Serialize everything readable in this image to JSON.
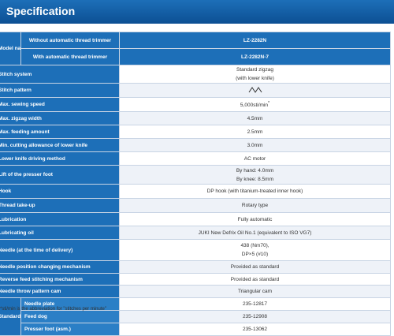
{
  "page": {
    "title": "Specification"
  },
  "header": {
    "model_name_label": "Model name",
    "without_trimmer_label": "Without automatic thread trimmer",
    "without_trimmer_model": "LZ-2282N",
    "with_trimmer_label": "With automatic thread trimmer",
    "with_trimmer_model": "LZ-2282N-7"
  },
  "rows": [
    {
      "label": "Stitch system",
      "values": [
        "Standard zigzag",
        "(with lower knife)"
      ]
    },
    {
      "label": "Stitch pattern",
      "icon": "zigzag-stitch-icon"
    },
    {
      "label": "Max. sewing speed",
      "value": "5,000sti/min",
      "sup": "*"
    },
    {
      "label": "Max. zigzag width",
      "value": "4.5mm"
    },
    {
      "label": "Max. feeding amount",
      "value": "2.5mm"
    },
    {
      "label": "Min. cutting allowance of lower knife",
      "value": "3.0mm"
    },
    {
      "label": "Lower knife driving method",
      "value": "AC motor"
    },
    {
      "label": "Lift of the presser foot",
      "values": [
        "By hand: 4.0mm",
        "By knee: 8.5mm"
      ]
    },
    {
      "label": "Hook",
      "value": "DP hook (with titanium-treated inner hook)"
    },
    {
      "label": "Thread take-up",
      "value": "Rotary type"
    },
    {
      "label": "Lubrication",
      "value": "Fully automatic"
    },
    {
      "label": "Lubricating oil",
      "value": "JUKI New Defrix Oil No.1 (equivalent to ISO VG7)"
    },
    {
      "label": "Needle (at the time of delivery)",
      "values": [
        "438 (Nm70),",
        "DP×5 (#10)"
      ]
    },
    {
      "label": "Needle position changing mechanism",
      "value": "Provided as standard"
    },
    {
      "label": "Reverse feed stitching mechanism",
      "value": "Provided as standard"
    },
    {
      "label": "Needle throw pattern cam",
      "value": "Triangular cam"
    }
  ],
  "gauge": {
    "group_label": "Standard gauge (at the time of delivery)",
    "items": [
      {
        "label": "Needle plate",
        "value": "235-12817"
      },
      {
        "label": "Feed dog",
        "value": "235-12908"
      },
      {
        "label": "Presser foot (asm.)",
        "value": "235-13062"
      }
    ]
  },
  "footnote": "*sti/min is the abbreviation for \"stitches per minute\"",
  "colors": {
    "header_blue": "#1d6fb8",
    "row_alt": "#eef2f8",
    "border": "#c8d4e4"
  }
}
